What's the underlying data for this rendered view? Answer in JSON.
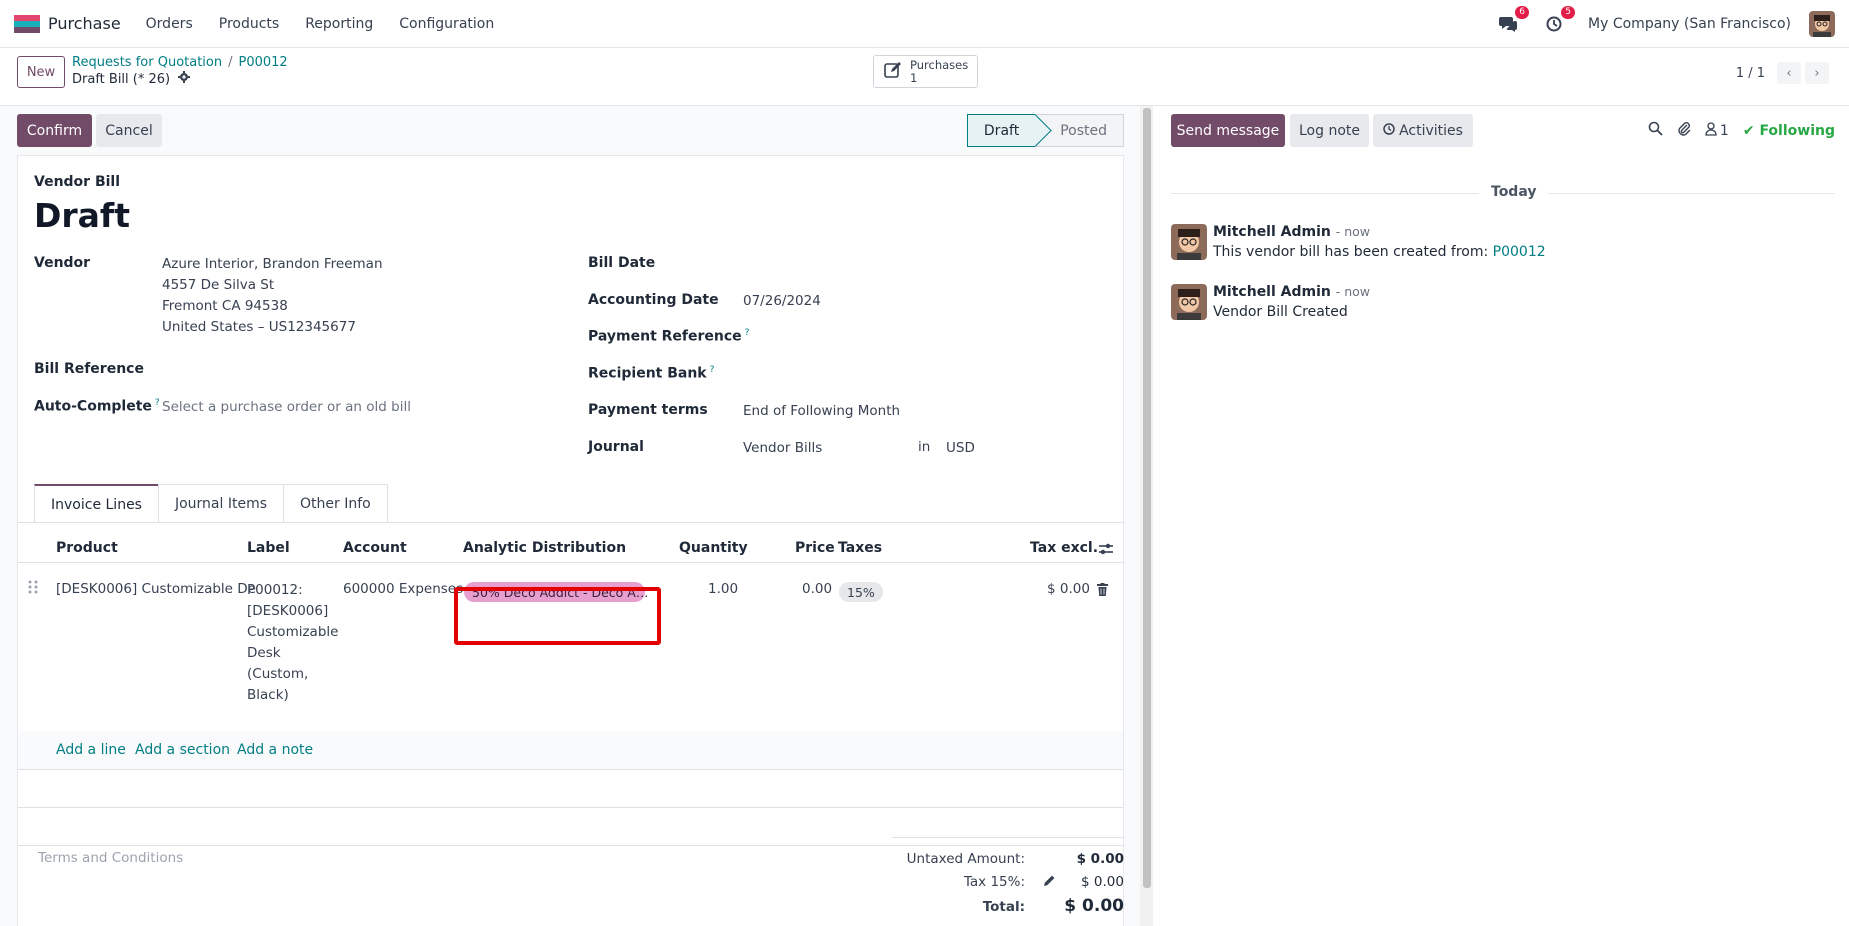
{
  "navbar": {
    "app_name": "Purchase",
    "menu": [
      "Orders",
      "Products",
      "Reporting",
      "Configuration"
    ],
    "messages_badge": "6",
    "activities_badge": "5",
    "company": "My Company (San Francisco)"
  },
  "control_panel": {
    "new_label": "New",
    "breadcrumb": [
      "Requests for Quotation",
      "P00012"
    ],
    "record_name": "Draft Bill (* 26)",
    "smart_button": {
      "label": "Purchases",
      "count": "1"
    },
    "pager": "1 / 1"
  },
  "statusbar": {
    "confirm_label": "Confirm",
    "cancel_label": "Cancel",
    "stages": [
      "Draft",
      "Posted"
    ],
    "active_stage": "Draft"
  },
  "form": {
    "subtitle": "Vendor Bill",
    "title": "Draft",
    "vendor_label": "Vendor",
    "vendor_name": "Azure Interior, Brandon Freeman",
    "vendor_address": [
      "4557 De Silva St",
      "Fremont CA 94538",
      "United States – US12345677"
    ],
    "bill_reference_label": "Bill Reference",
    "auto_complete_label": "Auto-Complete",
    "auto_complete_placeholder": "Select a purchase order or an old bill",
    "bill_date_label": "Bill Date",
    "accounting_date_label": "Accounting Date",
    "accounting_date": "07/26/2024",
    "payment_reference_label": "Payment Reference",
    "recipient_bank_label": "Recipient Bank",
    "payment_terms_label": "Payment terms",
    "payment_terms": "End of Following Month",
    "journal_label": "Journal",
    "journal": "Vendor Bills",
    "journal_in": "in",
    "currency": "USD",
    "help_mark": "?"
  },
  "tabs": [
    "Invoice Lines",
    "Journal Items",
    "Other Info"
  ],
  "lines": {
    "headers": [
      "Product",
      "Label",
      "Account",
      "Analytic Distribution",
      "Quantity",
      "Price",
      "Taxes",
      "Tax excl."
    ],
    "rows": [
      {
        "product": "[DESK0006] Customizable De",
        "label_lines": [
          "P00012:",
          "[DESK0006]",
          "Customizable",
          "Desk",
          "(Custom,",
          "Black)"
        ],
        "account": "600000 Expenses",
        "analytic": "50% Deco Addict - Deco A…",
        "quantity": "1.00",
        "price": "0.00",
        "tax": "15%",
        "subtotal": "$ 0.00"
      }
    ],
    "add_line": "Add a line",
    "add_section": "Add a section",
    "add_note": "Add a note"
  },
  "footer": {
    "terms_placeholder": "Terms and Conditions",
    "untaxed_label": "Untaxed Amount:",
    "untaxed_value": "$ 0.00",
    "tax_label": "Tax 15%:",
    "tax_value": "$ 0.00",
    "total_label": "Total:",
    "total_value": "$ 0.00"
  },
  "chatter": {
    "send_message": "Send message",
    "log_note": "Log note",
    "activities": "Activities",
    "followers_count": "1",
    "following": "Following",
    "date_separator": "Today",
    "messages": [
      {
        "author": "Mitchell Admin",
        "time": "- now",
        "body": "This vendor bill has been created from: ",
        "link": "P00012"
      },
      {
        "author": "Mitchell Admin",
        "time": "- now",
        "body": "Vendor Bill Created",
        "link": ""
      }
    ]
  },
  "colors": {
    "brand": "#714b67",
    "link": "#017e84",
    "highlight": "#e30000",
    "analytic_tag": "#e79fd0",
    "following": "#28a745"
  }
}
